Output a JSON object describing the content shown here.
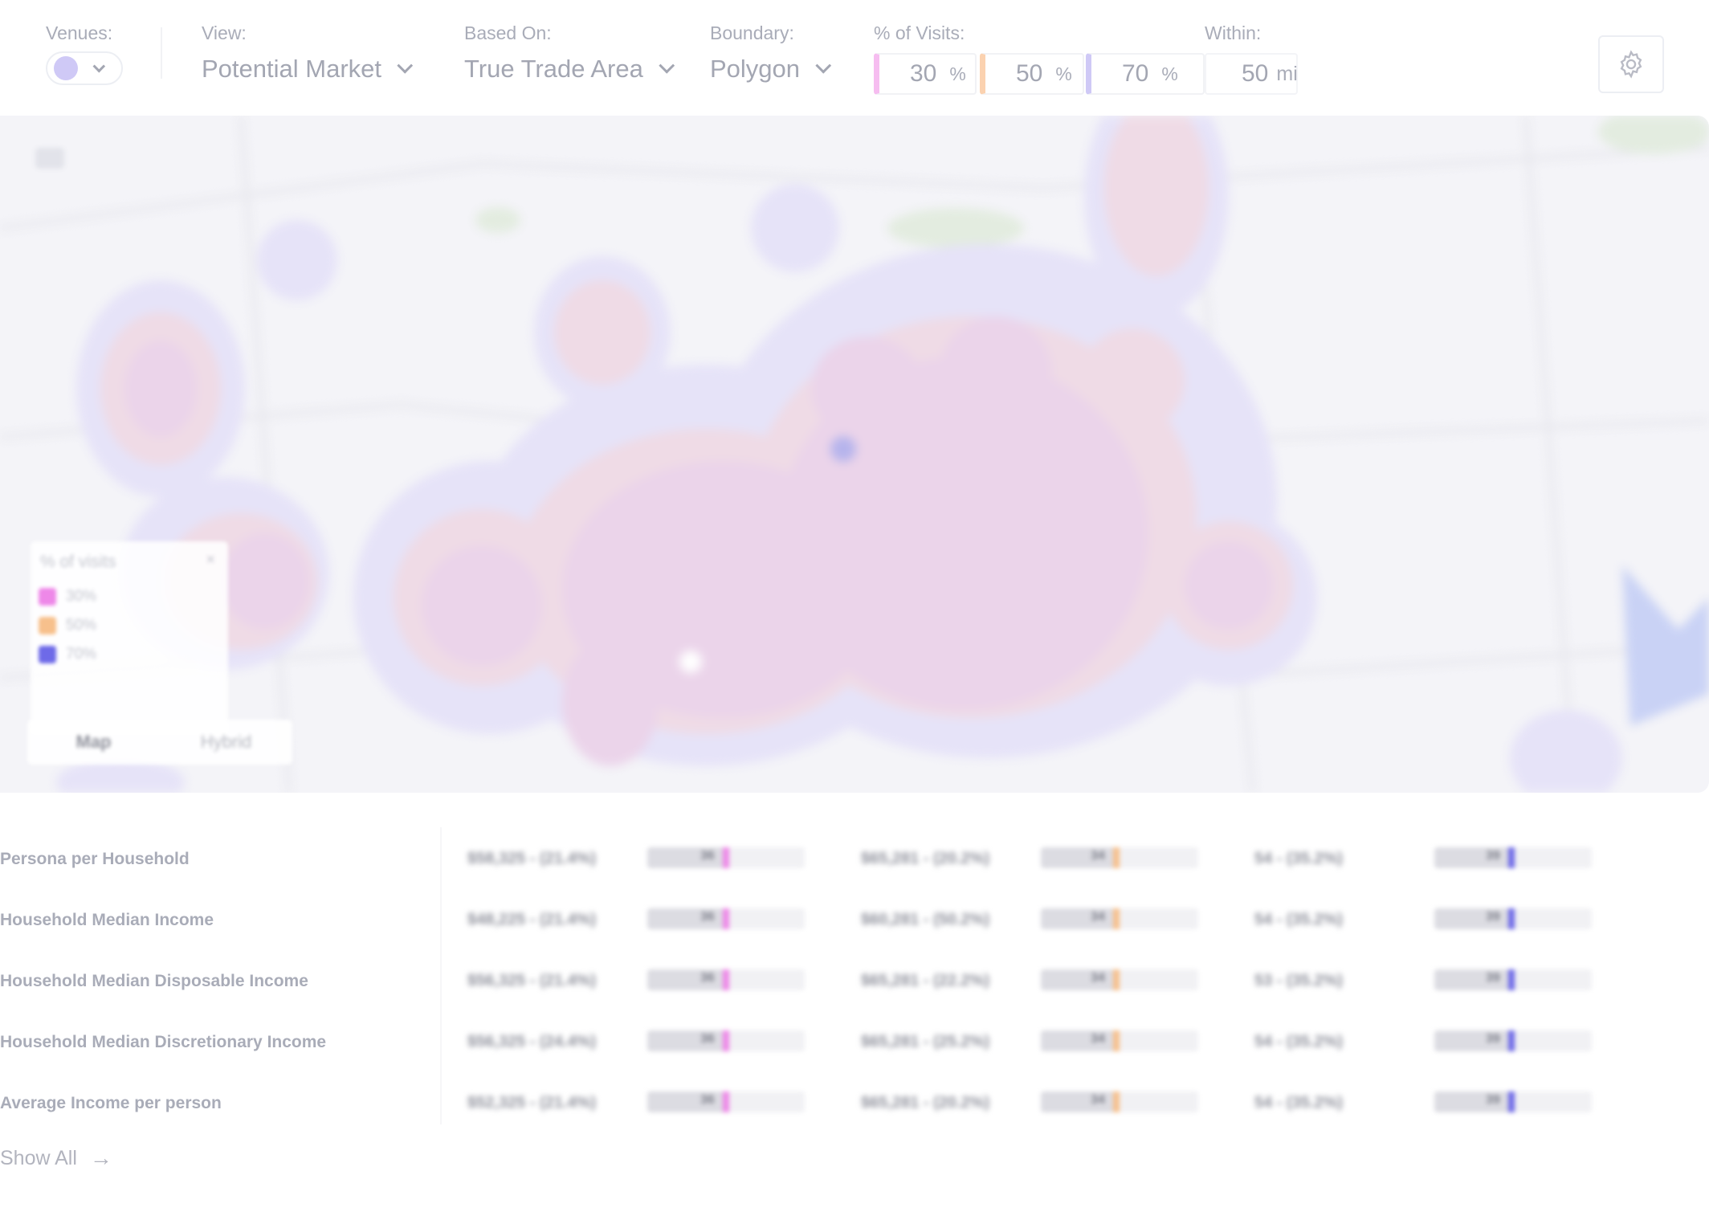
{
  "filters": {
    "venues": {
      "label": "Venues:",
      "dot_color": "#cfc9f6"
    },
    "view": {
      "label": "View:",
      "value": "Potential Market"
    },
    "based_on": {
      "label": "Based On:",
      "value": "True Trade Area"
    },
    "boundary": {
      "label": "Boundary:",
      "value": "Polygon"
    },
    "visits": {
      "label": "% of Visits:",
      "tiers": [
        {
          "value": "30",
          "unit": "%",
          "color": "#f6bdf0"
        },
        {
          "value": "50",
          "unit": "%",
          "color": "#fbd2b0"
        },
        {
          "value": "70",
          "unit": "%",
          "color": "#cfc9f6"
        }
      ]
    },
    "within": {
      "label": "Within:",
      "value": "50",
      "unit": "mi"
    }
  },
  "map": {
    "legend": {
      "title": "% of visits",
      "close": "×",
      "items": [
        {
          "label": "30%",
          "color": "#ee88e8"
        },
        {
          "label": "50%",
          "color": "#f7c08c"
        },
        {
          "label": "70%",
          "color": "#6e6ae8"
        }
      ]
    },
    "toggle": {
      "map_label": "Map",
      "hybrid_label": "Hybrid"
    }
  },
  "table": {
    "rows": [
      {
        "label": "Persona per Household",
        "cells": [
          {
            "text": "$58,325 - (21.4%)",
            "bar": 0.49,
            "num": "36"
          },
          {
            "text": "$65,281 - (20.2%)",
            "bar": 0.47,
            "num": "34"
          },
          {
            "text": "54 - (35.2%)",
            "bar": 0.48,
            "num": "39"
          }
        ]
      },
      {
        "label": "Household Median Income",
        "cells": [
          {
            "text": "$48,225 - (21.4%)",
            "bar": 0.49,
            "num": "36"
          },
          {
            "text": "$60,281 - (50.2%)",
            "bar": 0.47,
            "num": "34"
          },
          {
            "text": "54 - (35.2%)",
            "bar": 0.48,
            "num": "39"
          }
        ]
      },
      {
        "label": "Household Median Disposable Income",
        "cells": [
          {
            "text": "$56,325 - (21.4%)",
            "bar": 0.49,
            "num": "36"
          },
          {
            "text": "$65,281 - (22.2%)",
            "bar": 0.47,
            "num": "34"
          },
          {
            "text": "53 - (35.2%)",
            "bar": 0.48,
            "num": "39"
          }
        ]
      },
      {
        "label": "Household Median Discretionary Income",
        "cells": [
          {
            "text": "$56,325 - (24.4%)",
            "bar": 0.49,
            "num": "36"
          },
          {
            "text": "$65,281 - (25.2%)",
            "bar": 0.47,
            "num": "34"
          },
          {
            "text": "54 - (35.2%)",
            "bar": 0.48,
            "num": "39"
          }
        ]
      },
      {
        "label": "Average Income per person",
        "cells": [
          {
            "text": "$52,325 - (21.4%)",
            "bar": 0.49,
            "num": "36"
          },
          {
            "text": "$65,281 - (20.2%)",
            "bar": 0.47,
            "num": "34"
          },
          {
            "text": "54 - (35.2%)",
            "bar": 0.48,
            "num": "39"
          }
        ]
      }
    ],
    "column_colors": [
      "#ee88e8",
      "#f7c08c",
      "#6e6ae8"
    ],
    "show_all_label": "Show All"
  }
}
